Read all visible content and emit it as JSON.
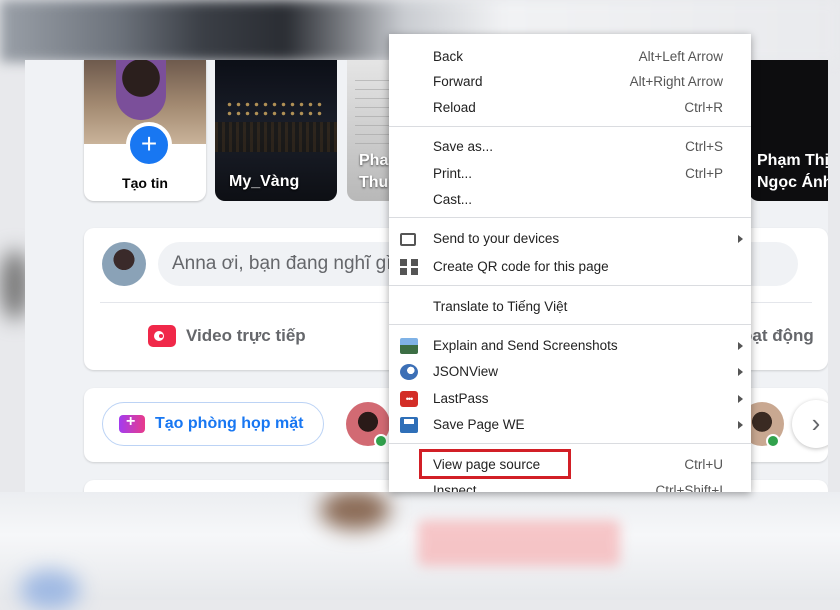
{
  "stories": [
    {
      "label": "Tạo tin"
    },
    {
      "label": "My_Vàng"
    },
    {
      "label_line1": "Pha",
      "label_line2": "Thu"
    },
    {
      "label_line1": "Phạm Thị",
      "label_line2": "Ngọc Ánh"
    }
  ],
  "composer": {
    "placeholder": "Anna ơi, bạn đang nghĩ gì thế?",
    "live_video": "Video trực tiếp",
    "activity_partial": "oạt động"
  },
  "room": {
    "create_room": "Tạo phòng họp mặt"
  },
  "context_menu": {
    "items": [
      {
        "label": "Back",
        "shortcut": "Alt+Left Arrow"
      },
      {
        "label": "Forward",
        "shortcut": "Alt+Right Arrow"
      },
      {
        "label": "Reload",
        "shortcut": "Ctrl+R"
      },
      {
        "label": "Save as...",
        "shortcut": "Ctrl+S"
      },
      {
        "label": "Print...",
        "shortcut": "Ctrl+P"
      },
      {
        "label": "Cast..."
      },
      {
        "label": "Send to your devices",
        "icon": "device-icon"
      },
      {
        "label": "Create QR code for this page",
        "icon": "qr-code-icon"
      },
      {
        "label": "Translate to Tiếng Việt"
      },
      {
        "label": "Explain and Send Screenshots",
        "icon": "screenshot-extension-icon"
      },
      {
        "label": "JSONView",
        "icon": "jsonview-icon"
      },
      {
        "label": "LastPass",
        "icon": "lastpass-icon",
        "icon_text": "•••"
      },
      {
        "label": "Save Page WE",
        "icon": "save-page-icon"
      },
      {
        "label": "View page source",
        "shortcut": "Ctrl+U"
      },
      {
        "label": "Inspect",
        "shortcut": "Ctrl+Shift+I"
      }
    ]
  },
  "colors": {
    "highlight": "#d21f26",
    "facebook_blue": "#1877f2",
    "live_red": "#f02849",
    "online_green": "#31a24c"
  }
}
